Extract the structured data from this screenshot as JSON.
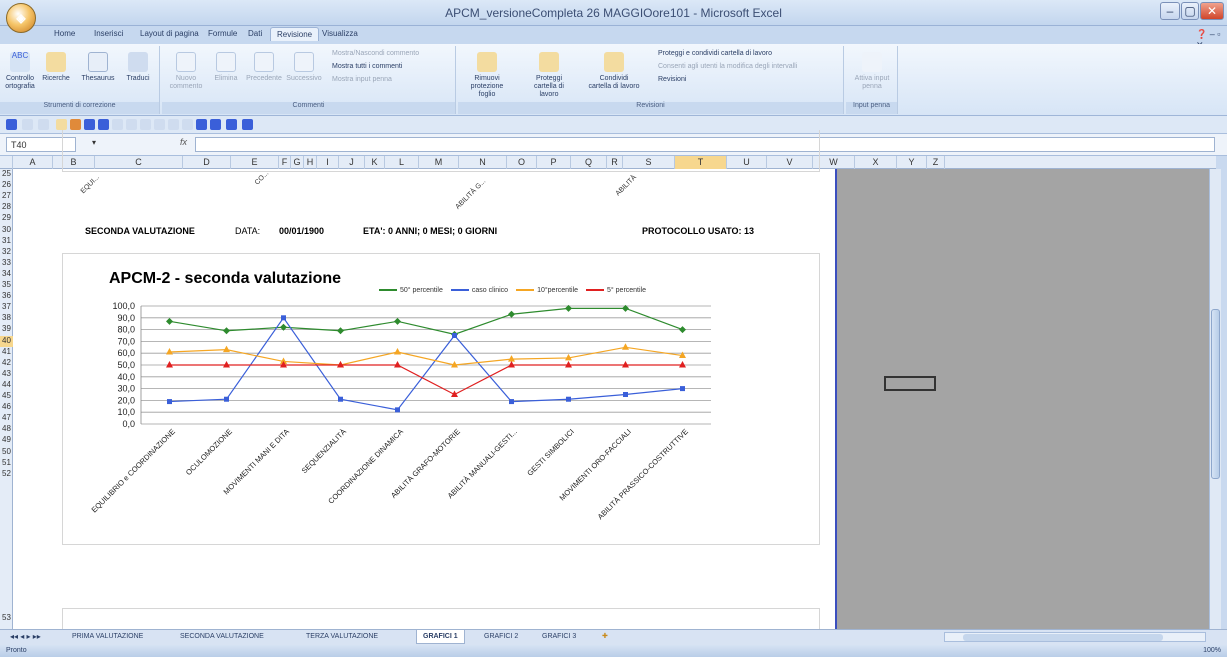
{
  "window": {
    "title": "APCM_versioneCompleta 26 MAGGIOore101 - Microsoft Excel",
    "minimize": "–",
    "maximize": "▢",
    "close": "✕"
  },
  "ribbon_tabs": [
    "Home",
    "Inserisci",
    "Layout di pagina",
    "Formule",
    "Dati",
    "Revisione",
    "Visualizza"
  ],
  "ribbon": {
    "groups": {
      "correzione": {
        "label": "Strumenti di correzione",
        "buttons": [
          "Controllo ortografia",
          "Ricerche",
          "Thesaurus",
          "Traduci"
        ]
      },
      "commenti": {
        "label": "Commenti",
        "buttons": [
          "Nuovo commento",
          "Elimina",
          "Precedente",
          "Successivo"
        ],
        "small": [
          "Mostra/Nascondi commento",
          "Mostra tutti i commenti",
          "Mostra input penna"
        ]
      },
      "revisioni": {
        "label": "Revisioni",
        "buttons": [
          "Rimuovi protezione foglio",
          "Proteggi cartella di lavoro",
          "Condividi cartella di lavoro"
        ],
        "small": [
          "Proteggi e condividi cartella di lavoro",
          "Consenti agli utenti la modifica degli intervalli",
          "Revisioni"
        ]
      },
      "penna": {
        "label": "Input penna",
        "buttons": [
          "Attiva input penna"
        ]
      }
    }
  },
  "formula_bar": {
    "name_box": "T40",
    "fx": "fx",
    "value": ""
  },
  "columns": [
    "A",
    "B",
    "C",
    "D",
    "E",
    "F",
    "G",
    "H",
    "I",
    "J",
    "K",
    "L",
    "M",
    "N",
    "O",
    "P",
    "Q",
    "R",
    "S",
    "T",
    "U",
    "V",
    "W",
    "X",
    "Y",
    "Z"
  ],
  "rows": [
    "25",
    "26",
    "27",
    "28",
    "29",
    "30",
    "31",
    "32",
    "33",
    "34",
    "35",
    "36",
    "37",
    "38",
    "39",
    "40",
    "41",
    "42",
    "43",
    "44",
    "45",
    "46",
    "47",
    "48",
    "49",
    "50",
    "51",
    "52",
    "53"
  ],
  "selected_column": "T",
  "selected_row": "40",
  "info_row": {
    "title": "SECONDA VALUTAZIONE",
    "data_label": "DATA:",
    "data_value": "00/01/1900",
    "eta": "ETA': 0 ANNI; 0 MESI; 0 GIORNI",
    "protocollo": "PROTOCOLLO USATO: 13"
  },
  "prev_chart_labels": [
    "EQUI...",
    "CO...",
    "ABILITÀ G...",
    "ABILITÀ"
  ],
  "chart_data": {
    "type": "line",
    "title": "APCM-2  - seconda valutazione",
    "categories": [
      "EQUILIBRIO e COORDINAZIONE",
      "OCULOMOZIONE",
      "MOVIMENTI MANI E DITA",
      "SEQUENZIALITÀ",
      "COORDINAZIONE DINAMICA",
      "ABILITÀ GRAFO-MOTORIE",
      "ABILITÀ MANUALI-GESTI...",
      "GESTI SIMBOLICI",
      "MOVIMENTI ORO-FACCIALI",
      "ABILITÀ PRASSICO-COSTRUTTIVE"
    ],
    "ylim": [
      0,
      100
    ],
    "yticks": [
      "0,0",
      "10,0",
      "20,0",
      "30,0",
      "40,0",
      "50,0",
      "60,0",
      "70,0",
      "80,0",
      "90,0",
      "100,0"
    ],
    "grid": true,
    "legend_position": "top-right",
    "series": [
      {
        "name": "50° percentile",
        "color": "#2e8b2e",
        "marker": "diamond",
        "values": [
          87,
          79,
          82,
          79,
          87,
          76,
          93,
          98,
          98,
          80
        ]
      },
      {
        "name": "caso clinico",
        "color": "#3a5fd9",
        "marker": "square",
        "values": [
          19,
          21,
          90,
          21,
          12,
          75,
          19,
          21,
          25,
          30
        ]
      },
      {
        "name": "10°percentile",
        "color": "#f5a623",
        "marker": "triangle",
        "values": [
          61,
          63,
          53,
          50,
          61,
          50,
          55,
          56,
          65,
          58
        ]
      },
      {
        "name": "5° percentile",
        "color": "#e02020",
        "marker": "triangle",
        "values": [
          50,
          50,
          50,
          50,
          50,
          25,
          50,
          50,
          50,
          50
        ]
      }
    ]
  },
  "sheet_tabs": [
    "PRIMA VALUTAZIONE",
    "SECONDA VALUTAZIONE",
    "TERZA VALUTAZIONE",
    "GRAFICI 1",
    "GRAFICI 2",
    "GRAFICI 3"
  ],
  "active_sheet": "GRAFICI 1",
  "status": {
    "text": "Pronto",
    "zoom": "100%"
  }
}
